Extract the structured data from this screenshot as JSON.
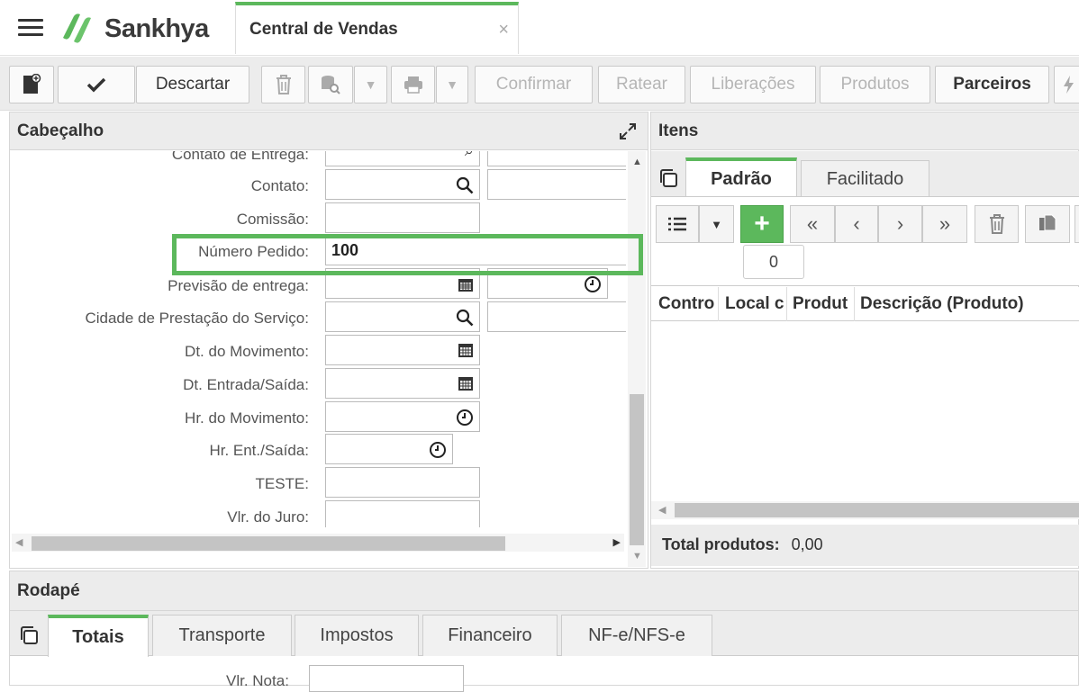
{
  "app": {
    "brand": "Sankhya",
    "tab_title": "Central de Vendas",
    "close_symbol": "×"
  },
  "toolbar": {
    "discard_label": "Descartar",
    "confirm_label": "Confirmar",
    "ratear_label": "Ratear",
    "liberacoes_label": "Liberações",
    "produtos_label": "Produtos",
    "parceiros_label": "Parceiros"
  },
  "cabecalho": {
    "title": "Cabeçalho",
    "fields": [
      {
        "label": "Contato de Entrega:"
      },
      {
        "label": "Contato:"
      },
      {
        "label": "Comissão:"
      },
      {
        "label": "Número Pedido:",
        "value": "100"
      },
      {
        "label": "Previsão de entrega:"
      },
      {
        "label": "Cidade de Prestação do Serviço:"
      },
      {
        "label": "Dt. do Movimento:"
      },
      {
        "label": "Dt. Entrada/Saída:"
      },
      {
        "label": "Hr. do Movimento:"
      },
      {
        "label": "Hr. Ent./Saída:"
      },
      {
        "label": "TESTE:"
      },
      {
        "label": "Vlr. do Juro:"
      }
    ]
  },
  "itens": {
    "title": "Itens",
    "tabs": [
      "Padrão",
      "Facilitado"
    ],
    "tooltip_count": "0",
    "columns": [
      "Contro",
      "Local c",
      "Produt",
      "Descrição (Produto)"
    ],
    "total_label": "Total produtos:",
    "total_value": "0,00"
  },
  "rodape": {
    "title": "Rodapé",
    "tabs": [
      "Totais",
      "Transporte",
      "Impostos",
      "Financeiro",
      "NF-e/NFS-e"
    ],
    "vlr_nota_label": "Vlr. Nota:"
  },
  "colors": {
    "accent": "#5cb85c",
    "highlight": "#5cb85c"
  }
}
